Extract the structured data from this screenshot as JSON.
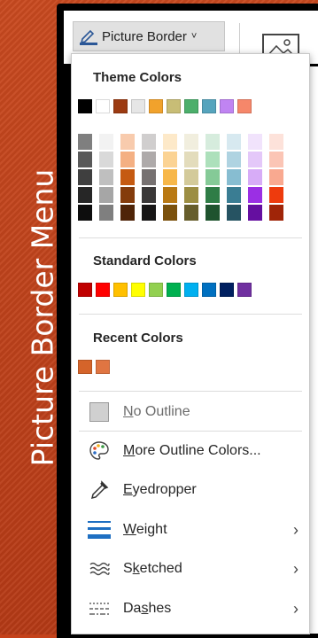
{
  "side_title": "Picture Border Menu",
  "ribbon": {
    "button_label": "Picture Border",
    "button_chevron": "˅"
  },
  "menu": {
    "theme_header": "Theme Colors",
    "standard_header": "Standard Colors",
    "recent_header": "Recent Colors",
    "theme_top": [
      "#000000",
      "#ffffff",
      "#9c3b12",
      "#e6e6e6",
      "#f1a22c",
      "#c8bd76",
      "#4caf6b",
      "#56a4bd",
      "#c084f2",
      "#f6876a"
    ],
    "theme_shades": [
      [
        "#7f7f7f",
        "#595959",
        "#3f3f3f",
        "#262626",
        "#0d0d0d"
      ],
      [
        "#f2f2f2",
        "#d9d9d9",
        "#bfbfbf",
        "#a6a6a6",
        "#7f7f7f"
      ],
      [
        "#f8cbad",
        "#f4b083",
        "#c55a11",
        "#843c0c",
        "#4f2408"
      ],
      [
        "#d0cece",
        "#aeaaaa",
        "#767171",
        "#3a3838",
        "#171616"
      ],
      [
        "#fde9c9",
        "#fbd394",
        "#f7b749",
        "#b97913",
        "#7b510c"
      ],
      [
        "#f1eede",
        "#e3dcbc",
        "#d3ca9a",
        "#9c8e43",
        "#675e2c"
      ],
      [
        "#d6ecdd",
        "#ade0bb",
        "#85ca97",
        "#2f7d46",
        "#1f532e"
      ],
      [
        "#d7e9f0",
        "#afd3e1",
        "#87bdd1",
        "#3a7d93",
        "#265362"
      ],
      [
        "#f1e3fc",
        "#e4c8f9",
        "#d7acf7",
        "#9b2fe4",
        "#650fa0"
      ],
      [
        "#fde2da",
        "#fbc5b5",
        "#f9a990",
        "#ee3b0d",
        "#a02508"
      ]
    ],
    "standard": [
      "#c00000",
      "#ff0000",
      "#ffc000",
      "#ffff00",
      "#92d050",
      "#00b050",
      "#00b0f0",
      "#0070c0",
      "#002060",
      "#7030a0"
    ],
    "recent": [
      "#d5642a",
      "#e07542"
    ],
    "items": [
      {
        "label_pre": "",
        "label_u": "N",
        "label_post": "o Outline",
        "icon": "no-outline-swatch-icon"
      },
      {
        "label_pre": "",
        "label_u": "M",
        "label_post": "ore Outline Colors...",
        "icon": "palette-icon"
      },
      {
        "label_pre": "",
        "label_u": "E",
        "label_post": "yedropper",
        "icon": "eyedropper-icon"
      },
      {
        "label_pre": "",
        "label_u": "W",
        "label_post": "eight",
        "icon": "weight-lines-icon",
        "submenu": "›"
      },
      {
        "label_pre": "S",
        "label_u": "k",
        "label_post": "etched",
        "icon": "sketched-icon",
        "submenu": "›"
      },
      {
        "label_pre": "Da",
        "label_u": "s",
        "label_post": "hes",
        "icon": "dashes-icon",
        "submenu": "›"
      }
    ]
  }
}
